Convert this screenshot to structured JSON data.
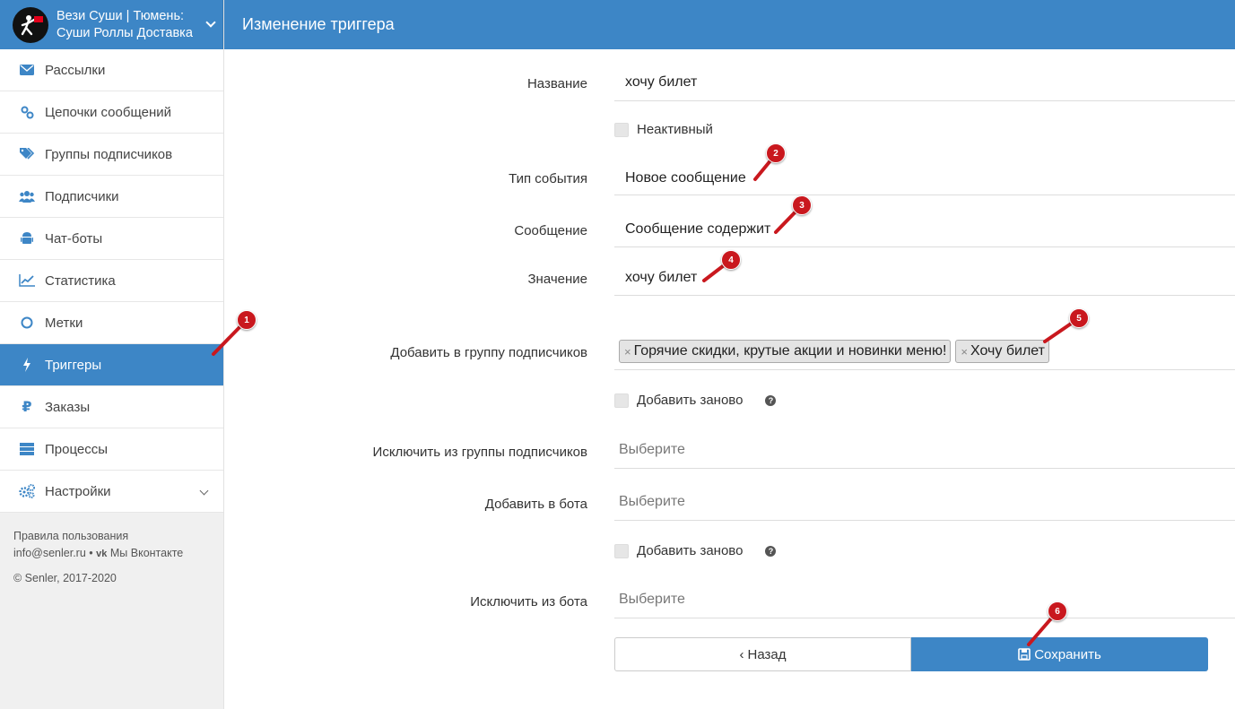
{
  "brand": {
    "name": "Вези Суши | Тюмень: Суши Роллы Доставка"
  },
  "sidebar": {
    "items": [
      {
        "label": "Рассылки",
        "icon": "envelope-icon"
      },
      {
        "label": "Цепочки сообщений",
        "icon": "link-icon"
      },
      {
        "label": "Группы подписчиков",
        "icon": "tags-icon"
      },
      {
        "label": "Подписчики",
        "icon": "users-icon"
      },
      {
        "label": "Чат-боты",
        "icon": "android-icon"
      },
      {
        "label": "Статистика",
        "icon": "chart-line-icon"
      },
      {
        "label": "Метки",
        "icon": "circle-icon"
      },
      {
        "label": "Триггеры",
        "icon": "bolt-icon",
        "active": true
      },
      {
        "label": "Заказы",
        "icon": "ruble-icon"
      },
      {
        "label": "Процессы",
        "icon": "server-icon"
      },
      {
        "label": "Настройки",
        "icon": "gears-icon"
      }
    ],
    "footer": {
      "terms": "Правила пользования",
      "email": "info@senler.ru",
      "sep": "•",
      "vk_label": "Мы Вконтакте",
      "copyright": "© Senler, 2017-2020"
    }
  },
  "header": {
    "title": "Изменение триггера"
  },
  "form": {
    "name_label": "Название",
    "name_value": "хочу билет",
    "inactive_label": "Неактивный",
    "event_label": "Тип события",
    "event_value": "Новое сообщение",
    "message_label": "Сообщение",
    "message_value": "Сообщение содержит",
    "value_label": "Значение",
    "value_value": "хочу билет",
    "add_group_label": "Добавить в группу подписчиков",
    "add_group_tags": [
      "Горячие скидки, крутые акции и новинки меню!",
      "Хочу билет"
    ],
    "tag_remove": "×",
    "re_add_label": "Добавить заново",
    "exclude_group_label": "Исключить из группы подписчиков",
    "exclude_group_placeholder": "Выберите",
    "add_bot_label": "Добавить в бота",
    "add_bot_placeholder": "Выберите",
    "re_add_bot_label": "Добавить заново",
    "exclude_bot_label": "Исключить из бота",
    "exclude_bot_placeholder": "Выберите",
    "help": "?"
  },
  "buttons": {
    "back": "Назад",
    "save": "Сохранить"
  },
  "markers": [
    "1",
    "2",
    "3",
    "4",
    "5",
    "6"
  ],
  "colors": {
    "accent": "#3d86c6",
    "marker": "#c9181e"
  }
}
